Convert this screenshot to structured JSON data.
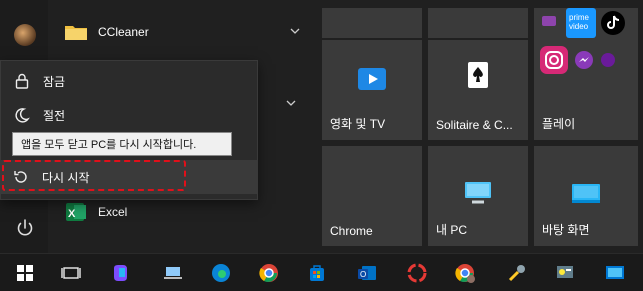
{
  "applist": {
    "items": [
      {
        "label": "CCleaner",
        "icon": "folder-icon"
      },
      {
        "label": "Excel",
        "icon": "excel-icon"
      }
    ]
  },
  "power_menu": {
    "lock_label": "잠금",
    "sleep_label": "절전",
    "tooltip": "앱을 모두 닫고 PC를 다시 시작합니다.",
    "restart_label": "다시 시작"
  },
  "tiles": {
    "movies": "영화 및 TV",
    "solitaire": "Solitaire & C...",
    "play": "플레이",
    "chrome": "Chrome",
    "mypc": "내 PC",
    "desktop": "바탕 화면"
  },
  "taskbar": {
    "icons": [
      "windows-start-icon",
      "task-view-icon",
      "copilot-icon",
      "laptop-icon",
      "edge-icon",
      "chrome-icon",
      "store-icon",
      "outlook-icon",
      "recorder-icon",
      "chrome-profile-icon",
      "tools-icon",
      "control-panel-icon",
      "remote-desktop-icon"
    ]
  },
  "colors": {
    "accent_outline": "#e0101a",
    "tile_bg": "#3a3a3a",
    "folder": "#f0c040"
  }
}
